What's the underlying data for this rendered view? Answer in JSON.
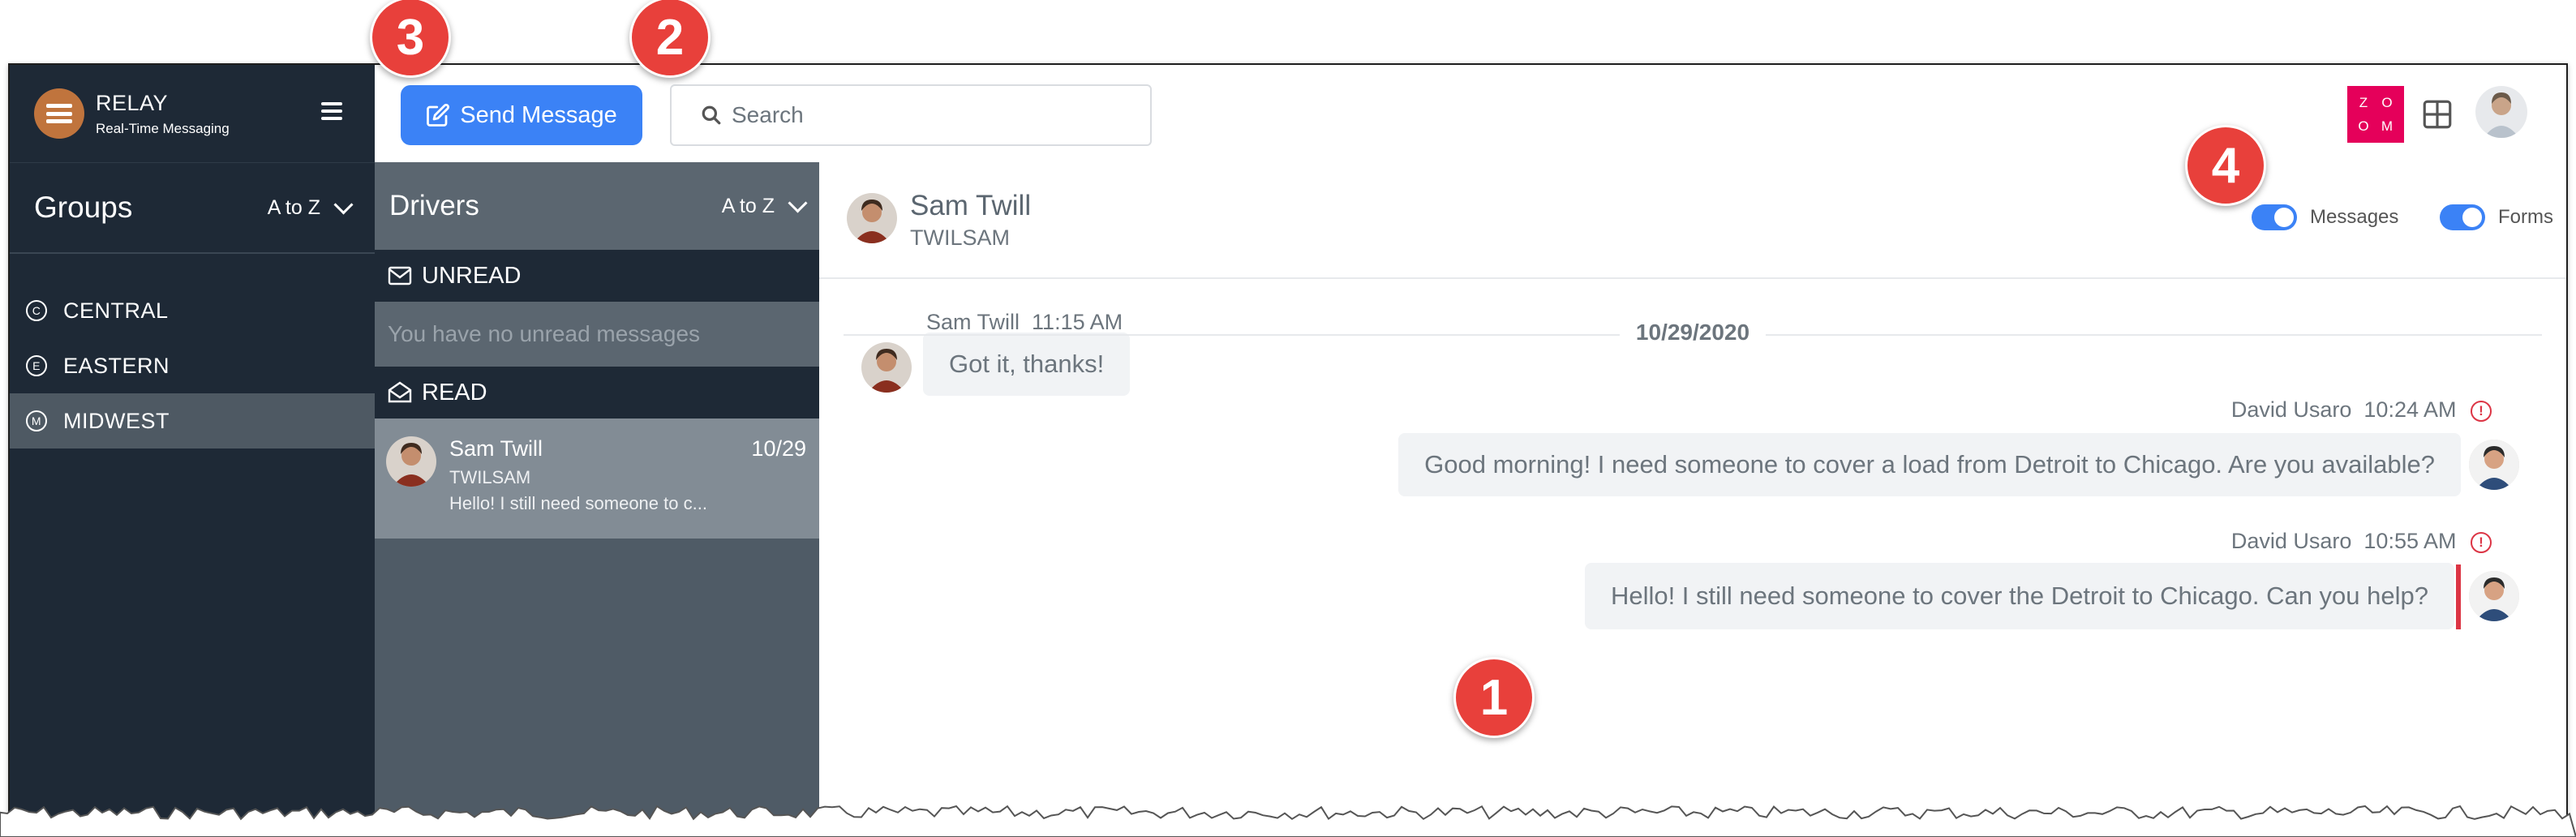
{
  "brand": {
    "name": "RELAY",
    "tagline": "Real-Time Messaging"
  },
  "groups": {
    "title": "Groups",
    "sort_label": "A to Z",
    "items": [
      {
        "letter": "C",
        "label": "CENTRAL"
      },
      {
        "letter": "E",
        "label": "EASTERN"
      },
      {
        "letter": "M",
        "label": "MIDWEST"
      }
    ]
  },
  "toolbar": {
    "send_label": "Send Message",
    "search_placeholder": "Search",
    "zoom_letters": [
      "Z",
      "O",
      "O",
      "M"
    ]
  },
  "drivers": {
    "title": "Drivers",
    "sort_label": "A to Z",
    "unread_label": "UNREAD",
    "unread_empty": "You have no unread messages",
    "read_label": "READ",
    "conversations": [
      {
        "name": "Sam Twill",
        "date": "10/29",
        "code": "TWILSAM",
        "snippet": "Hello! I still need someone to c..."
      }
    ]
  },
  "chat": {
    "name": "Sam Twill",
    "code": "TWILSAM",
    "toggles": [
      {
        "label": "Messages",
        "on": true
      },
      {
        "label": "Forms",
        "on": true
      }
    ],
    "date_separator": "10/29/2020",
    "messages": [
      {
        "sender": "Sam Twill",
        "time": "11:15 AM",
        "text": "Got it, thanks!"
      },
      {
        "sender": "David Usaro",
        "time": "10:24 AM",
        "text": "Good morning! I need someone to cover a load from Detroit to Chicago. Are you available?"
      },
      {
        "sender": "David Usaro",
        "time": "10:55 AM",
        "text": "Hello! I still need someone to cover the Detroit to Chicago. Can you help?"
      }
    ],
    "warn_symbol": "!"
  },
  "callouts": [
    "1",
    "2",
    "3",
    "4"
  ],
  "colors": {
    "accent": "#3b82f6",
    "sidebar": "#1e2936",
    "callout": "#e8403b",
    "zoom": "#e5005a"
  }
}
